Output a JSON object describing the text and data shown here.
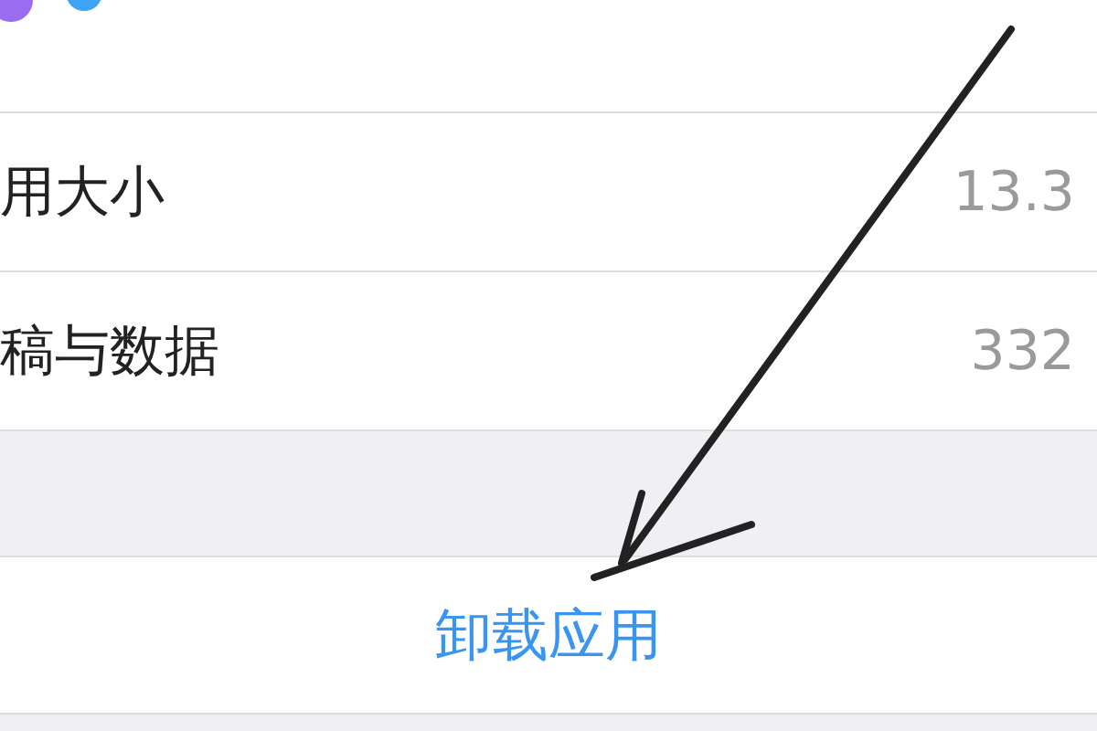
{
  "rows": [
    {
      "label": "用大小",
      "value": "13.3"
    },
    {
      "label": "稿与数据",
      "value": "332"
    }
  ],
  "action": {
    "label": "卸载应用"
  }
}
